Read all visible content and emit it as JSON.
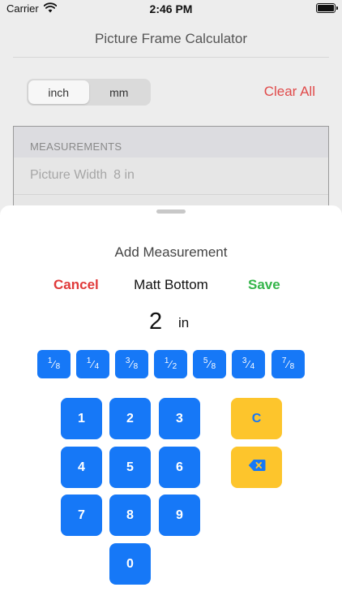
{
  "status_bar": {
    "carrier": "Carrier",
    "time": "2:46 PM"
  },
  "nav": {
    "title": "Picture Frame Calculator"
  },
  "units": {
    "options": [
      "inch",
      "mm"
    ],
    "selected": "inch"
  },
  "clear_all": "Clear All",
  "measurements": {
    "header": "MEASUREMENTS",
    "rows": [
      {
        "label": "Picture Width",
        "value": "8 in"
      }
    ]
  },
  "sheet": {
    "title": "Add Measurement",
    "cancel": "Cancel",
    "field": "Matt Bottom",
    "save": "Save",
    "amount": "2",
    "unit": "in",
    "fractions": [
      {
        "num": "1",
        "den": "8"
      },
      {
        "num": "1",
        "den": "4"
      },
      {
        "num": "3",
        "den": "8"
      },
      {
        "num": "1",
        "den": "2"
      },
      {
        "num": "5",
        "den": "8"
      },
      {
        "num": "3",
        "den": "4"
      },
      {
        "num": "7",
        "den": "8"
      }
    ],
    "keys": [
      "1",
      "2",
      "3",
      "4",
      "5",
      "6",
      "7",
      "8",
      "9",
      "0"
    ],
    "clear_key": "C"
  },
  "colors": {
    "accent_blue": "#1678f7",
    "clear_red": "#e04a4a",
    "save_green": "#34b54a",
    "key_yellow": "#fdc52c"
  }
}
